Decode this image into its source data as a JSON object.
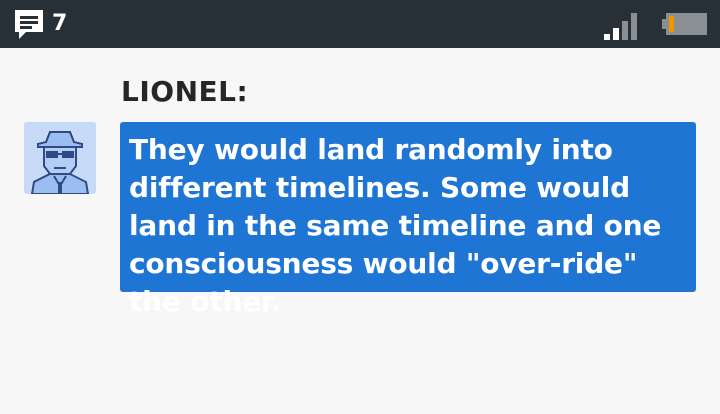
{
  "status_bar": {
    "notification_count": "7",
    "notification_icon": "chat-bubble-icon",
    "signal_icon": "signal-strength-icon",
    "battery_icon": "battery-low-icon",
    "battery_color": "#f29600",
    "background_color": "#263036"
  },
  "conversation": {
    "speaker_name": "LIONEL:",
    "avatar_icon": "pixel-portrait-man-with-hat-and-sunglasses",
    "message": "They would land randomly into different timelines. Some would land in the same timeline and one consciousness would \"over-ride\" the other.",
    "bubble_color": "#1f75d4"
  }
}
